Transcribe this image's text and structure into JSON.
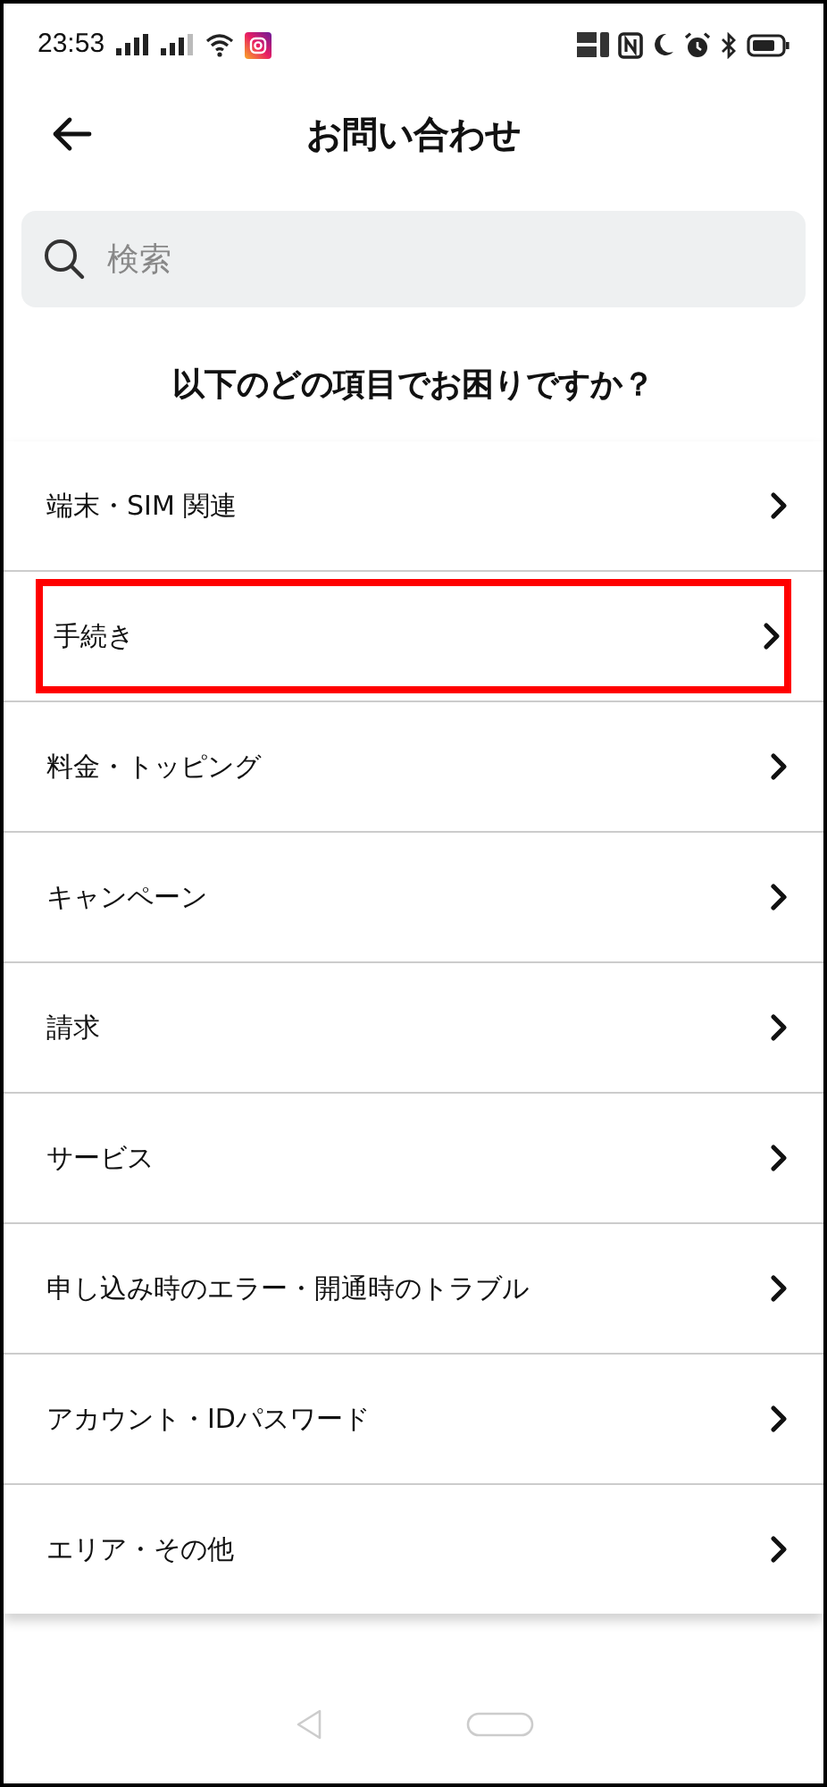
{
  "status_bar": {
    "time": "23:53"
  },
  "header": {
    "title": "お問い合わせ"
  },
  "search": {
    "placeholder": "検索"
  },
  "question": "以下のどの項目でお困りですか？",
  "items": [
    {
      "label": "端末・SIM 関連",
      "highlighted": false
    },
    {
      "label": "手続き",
      "highlighted": true
    },
    {
      "label": "料金・トッピング",
      "highlighted": false
    },
    {
      "label": "キャンペーン",
      "highlighted": false
    },
    {
      "label": "請求",
      "highlighted": false
    },
    {
      "label": "サービス",
      "highlighted": false
    },
    {
      "label": "申し込み時のエラー・開通時のトラブル",
      "highlighted": false
    },
    {
      "label": "アカウント・IDパスワード",
      "highlighted": false
    },
    {
      "label": "エリア・その他",
      "highlighted": false
    }
  ]
}
